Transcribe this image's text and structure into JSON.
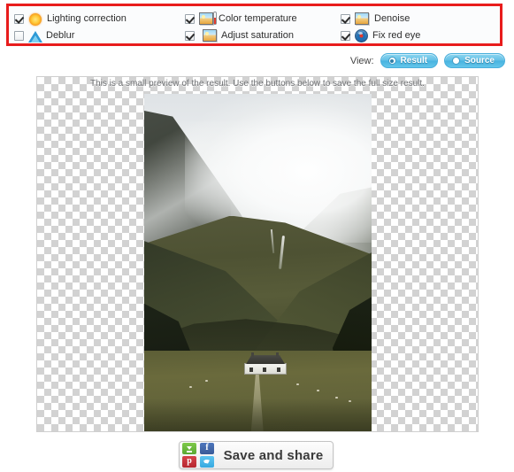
{
  "options_panel": {
    "highlight_color": "#e81c1c",
    "items": [
      {
        "label": "Lighting correction",
        "checked": true,
        "icon": "sun-icon",
        "column": 1,
        "row": 1
      },
      {
        "label": "Deblur",
        "checked": false,
        "icon": "cone-icon",
        "column": 1,
        "row": 2
      },
      {
        "label": "Color temperature",
        "checked": true,
        "icon": "thermometer-photo-icon",
        "column": 2,
        "row": 1
      },
      {
        "label": "Adjust saturation",
        "checked": true,
        "icon": "photo-stack-icon",
        "column": 2,
        "row": 2
      },
      {
        "label": "Denoise",
        "checked": true,
        "icon": "photo-icon",
        "column": 3,
        "row": 1
      },
      {
        "label": "Fix red eye",
        "checked": true,
        "icon": "red-eye-icon",
        "column": 3,
        "row": 2
      }
    ]
  },
  "view": {
    "label": "View:",
    "accent_color": "#5bc0e8",
    "options": [
      {
        "label": "Result",
        "selected": true
      },
      {
        "label": "Source",
        "selected": false
      }
    ]
  },
  "preview": {
    "note": "This is a small preview of the result. Use the buttons below to save the full size result.",
    "background": "transparency-checkerboard",
    "image_alt": "Misty green mountain valley with a white cottage and sheep in a field"
  },
  "share": {
    "button_label": "Save and share",
    "icons": [
      {
        "name": "download-icon",
        "glyph": "",
        "color": "#6cbb3c"
      },
      {
        "name": "facebook-icon",
        "glyph": "f",
        "color": "#4267b2"
      },
      {
        "name": "pinterest-icon",
        "glyph": "p",
        "color": "#c8232c"
      },
      {
        "name": "twitter-icon",
        "glyph": "",
        "color": "#43b0e3"
      }
    ]
  }
}
